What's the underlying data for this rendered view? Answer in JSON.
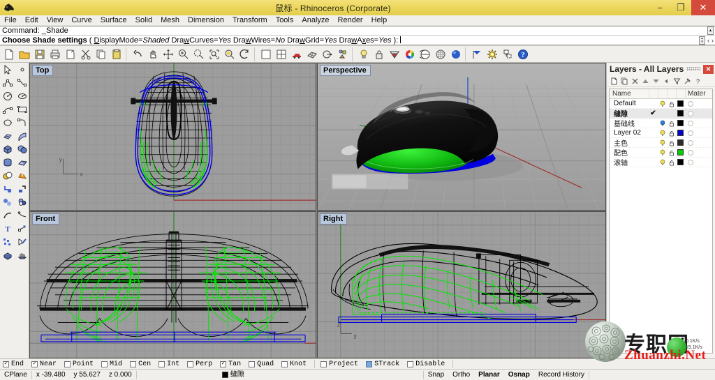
{
  "window": {
    "title": "鼠标 - Rhinoceros (Corporate)",
    "app_icon": "rhino-logo-icon",
    "minimize_label": "−",
    "restore_label": "❐",
    "close_label": "✕"
  },
  "menubar": {
    "items": [
      {
        "label": "File"
      },
      {
        "label": "Edit"
      },
      {
        "label": "View"
      },
      {
        "label": "Curve"
      },
      {
        "label": "Surface"
      },
      {
        "label": "Solid"
      },
      {
        "label": "Mesh"
      },
      {
        "label": "Dimension"
      },
      {
        "label": "Transform"
      },
      {
        "label": "Tools"
      },
      {
        "label": "Analyze"
      },
      {
        "label": "Render"
      },
      {
        "label": "Help"
      }
    ]
  },
  "command": {
    "history_prefix": "Command:",
    "history_value": "_Shade",
    "prompt_label": "Choose Shade settings",
    "prompt_open": "(",
    "options": [
      {
        "name": "DisplayMode",
        "value": "Shaded"
      },
      {
        "name": "DrawCurves",
        "value": "Yes"
      },
      {
        "name": "DrawWires",
        "value": "No"
      },
      {
        "name": "DrawGrid",
        "value": "Yes"
      },
      {
        "name": "DrawAxes",
        "value": "Yes"
      }
    ],
    "prompt_close": "):",
    "nav_prev": "‹",
    "nav_next": "›"
  },
  "main_toolbar": {
    "buttons": [
      {
        "name": "new-file-icon",
        "label": "New"
      },
      {
        "name": "open-file-icon",
        "label": "Open"
      },
      {
        "name": "save-file-icon",
        "label": "Save"
      },
      {
        "name": "print-icon",
        "label": "Print"
      },
      {
        "name": "cut-to-clipboard-icon",
        "label": "Cut"
      },
      {
        "name": "scissors-icon",
        "label": "Cut"
      },
      {
        "name": "copy-icon",
        "label": "Copy"
      },
      {
        "name": "paste-icon",
        "label": "Paste"
      },
      {
        "name": "undo-icon",
        "label": "Undo"
      },
      {
        "name": "pan-hand-icon",
        "label": "Pan"
      },
      {
        "name": "move-axis-icon",
        "label": "Move"
      },
      {
        "name": "zoom-in-icon",
        "label": "Zoom In"
      },
      {
        "name": "zoom-out-icon",
        "label": "Zoom Out"
      },
      {
        "name": "zoom-window-icon",
        "label": "Zoom Window"
      },
      {
        "name": "zoom-selected-icon",
        "label": "Zoom Selected"
      },
      {
        "name": "rotate-view-icon",
        "label": "Rotate View"
      },
      {
        "name": "single-viewport-icon",
        "label": "Maximize Viewport"
      },
      {
        "name": "four-viewport-icon",
        "label": "4 Viewports"
      },
      {
        "name": "render-car-icon",
        "label": "Render"
      },
      {
        "name": "mesh-icon",
        "label": "Mesh"
      },
      {
        "name": "curve-from-object-icon",
        "label": "Curve"
      },
      {
        "name": "object-properties-icon",
        "label": "Properties"
      },
      {
        "name": "light-bulb-icon",
        "label": "Lights"
      },
      {
        "name": "lock-icon",
        "label": "Lock"
      },
      {
        "name": "render-color-icon",
        "label": "Render Color"
      },
      {
        "name": "color-wheel-icon",
        "label": "Color Wheel"
      },
      {
        "name": "shaded-sphere-icon",
        "label": "Shaded"
      },
      {
        "name": "ghosted-sphere-icon",
        "label": "Ghosted"
      },
      {
        "name": "render-preview-icon",
        "label": "Render Preview"
      },
      {
        "name": "flag-icon",
        "label": "Flag"
      },
      {
        "name": "options-gear-icon",
        "label": "Options"
      },
      {
        "name": "layout-icon",
        "label": "Layout"
      },
      {
        "name": "help-icon",
        "label": "Help"
      }
    ]
  },
  "left_toolbar": {
    "column_a": [
      {
        "name": "select-arrow-icon"
      },
      {
        "name": "point-object-icon"
      },
      {
        "name": "polyline-icon"
      },
      {
        "name": "circle-icon"
      },
      {
        "name": "arc-icon"
      },
      {
        "name": "curve-interp-icon"
      },
      {
        "name": "ellipse-icon"
      },
      {
        "name": "surface-edit-icon"
      },
      {
        "name": "box-solid-icon"
      },
      {
        "name": "cylinder-icon"
      },
      {
        "name": "boolean-union-icon"
      },
      {
        "name": "fillet-icon"
      },
      {
        "name": "transform-icon"
      },
      {
        "name": "curve-tools-icon"
      },
      {
        "name": "text-tool-icon"
      },
      {
        "name": "array-icon"
      },
      {
        "name": "mesh-tools-icon"
      }
    ],
    "column_b": [
      {
        "name": "point-cloud-icon"
      },
      {
        "name": "control-point-curve-icon"
      },
      {
        "name": "ellipse-center-icon"
      },
      {
        "name": "rectangle-icon"
      },
      {
        "name": "corner-curve-icon"
      },
      {
        "name": "surface-loft-icon"
      },
      {
        "name": "sphere-icon"
      },
      {
        "name": "surface-patch-icon"
      },
      {
        "name": "boolean-difference-icon"
      },
      {
        "name": "split-icon"
      },
      {
        "name": "sphere-group-icon"
      },
      {
        "name": "blend-curve-icon"
      },
      {
        "name": "scale-icon"
      },
      {
        "name": "extrude-icon"
      },
      {
        "name": "render-mesh-icon"
      }
    ]
  },
  "viewports": [
    {
      "name": "viewport-top",
      "label": "Top",
      "display_mode": "Wireframe"
    },
    {
      "name": "viewport-perspective",
      "label": "Perspective",
      "display_mode": "Shaded"
    },
    {
      "name": "viewport-front",
      "label": "Front",
      "display_mode": "Wireframe"
    },
    {
      "name": "viewport-right",
      "label": "Right",
      "display_mode": "Wireframe"
    }
  ],
  "layers_panel": {
    "title": "Layers - All Layers",
    "close_label": "✕",
    "tools": [
      {
        "name": "new-layer-icon",
        "glyph": "▯"
      },
      {
        "name": "copy-layer-icon",
        "glyph": "▱"
      },
      {
        "name": "delete-layer-icon",
        "glyph": "✕"
      },
      {
        "name": "move-layer-up-icon",
        "glyph": "▲"
      },
      {
        "name": "move-layer-down-icon",
        "glyph": "▼"
      },
      {
        "name": "back-arrow-icon",
        "glyph": "◀"
      },
      {
        "name": "filter-icon",
        "glyph": "▽"
      },
      {
        "name": "layer-tools-icon",
        "glyph": "⚒"
      },
      {
        "name": "layer-help-icon",
        "glyph": "?"
      }
    ],
    "columns": [
      "Name",
      "",
      "",
      "",
      "",
      "Mater"
    ],
    "header_name": "Name",
    "header_material": "Mater",
    "rows": [
      {
        "name": "Default",
        "current": false,
        "on": true,
        "bulb_color": "#e8dd55",
        "locked": false,
        "color": "#000000"
      },
      {
        "name": "缝隙",
        "current": true,
        "on": true,
        "bulb_color": "#e8dd55",
        "locked": false,
        "color": "#000000"
      },
      {
        "name": "基础线",
        "current": false,
        "on": true,
        "bulb_color": "#2e7fd4",
        "locked": false,
        "color": "#000000"
      },
      {
        "name": "Layer 02",
        "current": false,
        "on": true,
        "bulb_color": "#e8dd55",
        "locked": false,
        "color": "#0000cc"
      },
      {
        "name": "主色",
        "current": false,
        "on": true,
        "bulb_color": "#e8dd55",
        "locked": false,
        "color": "#2b2b2b"
      },
      {
        "name": "配色",
        "current": false,
        "on": true,
        "bulb_color": "#e8dd55",
        "locked": false,
        "color": "#00cc00"
      },
      {
        "name": "滚轴",
        "current": false,
        "on": true,
        "bulb_color": "#e8dd55",
        "locked": false,
        "color": "#000000"
      }
    ],
    "current_mark": "✔"
  },
  "osnap_bar": {
    "items": [
      {
        "label": "End",
        "checked": true,
        "style": "check"
      },
      {
        "label": "Near",
        "checked": true,
        "style": "check"
      },
      {
        "label": "Point",
        "checked": false,
        "style": "check"
      },
      {
        "label": "Mid",
        "checked": false,
        "style": "check"
      },
      {
        "label": "Cen",
        "checked": false,
        "style": "check"
      },
      {
        "label": "Int",
        "checked": false,
        "style": "check"
      },
      {
        "label": "Perp",
        "checked": false,
        "style": "check"
      },
      {
        "label": "Tan",
        "checked": true,
        "style": "check"
      },
      {
        "label": "Quad",
        "checked": false,
        "style": "check"
      },
      {
        "label": "Knot",
        "checked": false,
        "style": "check"
      },
      {
        "label": "Project",
        "checked": false,
        "style": "check"
      },
      {
        "label": "STrack",
        "checked": false,
        "style": "blue"
      },
      {
        "label": "Disable",
        "checked": false,
        "style": "check"
      }
    ]
  },
  "status_bar": {
    "cplane_label": "CPlane",
    "x_label": "x",
    "x_value": "-39.480",
    "y_label": "y",
    "y_value": "55.627",
    "z_label": "z",
    "z_value": "0.000",
    "current_layer": "缝隙",
    "current_layer_color": "#000000",
    "toggles": [
      {
        "label": "Snap",
        "active": false
      },
      {
        "label": "Ortho",
        "active": false
      },
      {
        "label": "Planar",
        "active": true
      },
      {
        "label": "Osnap",
        "active": true
      },
      {
        "label": "Record History",
        "active": false
      }
    ]
  },
  "watermark": {
    "text_cn": "专职网",
    "text_en": "Zhuanzhi.Net",
    "speed_up": "0.1K/s",
    "speed_down": "15.1K/s"
  },
  "colors": {
    "title_bar": "#ecd85f",
    "close_button": "#d44a3c",
    "viewport_bg": "#9d9d9d",
    "grid_line": "#8e8e8e",
    "axis_x": "#b03030",
    "axis_y": "#2e8b2e",
    "axis_z": "#3050c8",
    "wire_black": "#000000",
    "wire_green": "#00e800",
    "wire_blue": "#0000e0",
    "shaded_body": "#1a1a1a",
    "shaded_accent": "#00c000",
    "panel_bg": "#f0efeb"
  }
}
